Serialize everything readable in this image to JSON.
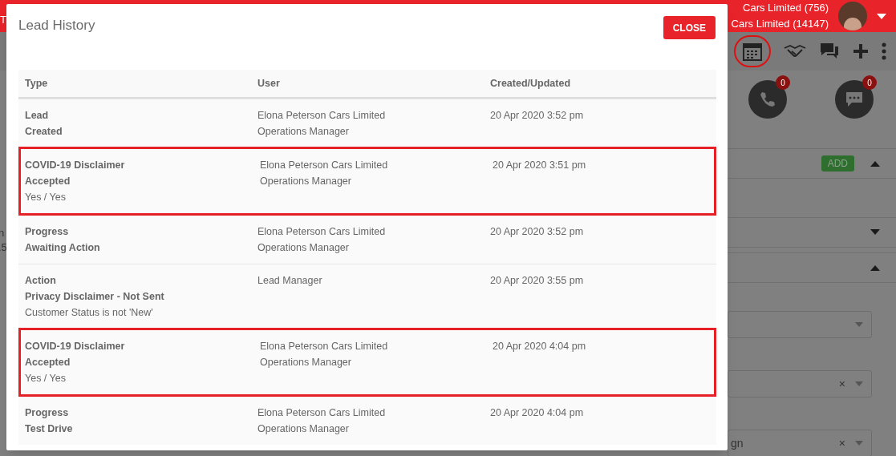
{
  "header": {
    "left_fragment": "T",
    "account_lines": [
      "Cars Limited (756)",
      "Cars Limited (14147)"
    ]
  },
  "toolbar": {
    "calendar_circled": true
  },
  "contact_badges": [
    "0",
    "0"
  ],
  "page": {
    "add_button": "ADD",
    "left_fragments": [
      "n",
      ".5"
    ],
    "select_fragment": "gn",
    "clear_marks": [
      "×",
      "×"
    ]
  },
  "modal": {
    "title": "Lead History",
    "close_button": "CLOSE",
    "columns": [
      "Type",
      "User",
      "Created/Updated"
    ],
    "rows": [
      {
        "title": "Lead",
        "status": "Created",
        "user": [
          "Elona Peterson Cars Limited",
          "Operations Manager"
        ],
        "date": "20 Apr 2020 3:52 pm",
        "highlighted": false
      },
      {
        "title": "COVID-19 Disclaimer",
        "status": "Accepted",
        "detail": "Yes / Yes",
        "user": [
          "Elona Peterson Cars Limited",
          "Operations Manager"
        ],
        "date": "20 Apr 2020 3:51 pm",
        "highlighted": true
      },
      {
        "title": "Progress",
        "status": "Awaiting Action",
        "user": [
          "Elona Peterson Cars Limited",
          "Operations Manager"
        ],
        "date": "20 Apr 2020 3:52 pm",
        "highlighted": false
      },
      {
        "title": "Action",
        "status": "Privacy Disclaimer - Not Sent",
        "detail": "Customer Status is not 'New'",
        "user": [
          "Lead Manager"
        ],
        "date": "20 Apr 2020 3:55 pm",
        "highlighted": false
      },
      {
        "title": "COVID-19 Disclaimer",
        "status": "Accepted",
        "detail": "Yes / Yes",
        "user": [
          "Elona Peterson Cars Limited",
          "Operations Manager"
        ],
        "date": "20 Apr 2020 4:04 pm",
        "highlighted": true
      },
      {
        "title": "Progress",
        "status": "Test Drive",
        "user": [
          "Elona Peterson Cars Limited",
          "Operations Manager"
        ],
        "date": "20 Apr 2020 4:04 pm",
        "highlighted": false
      }
    ]
  }
}
